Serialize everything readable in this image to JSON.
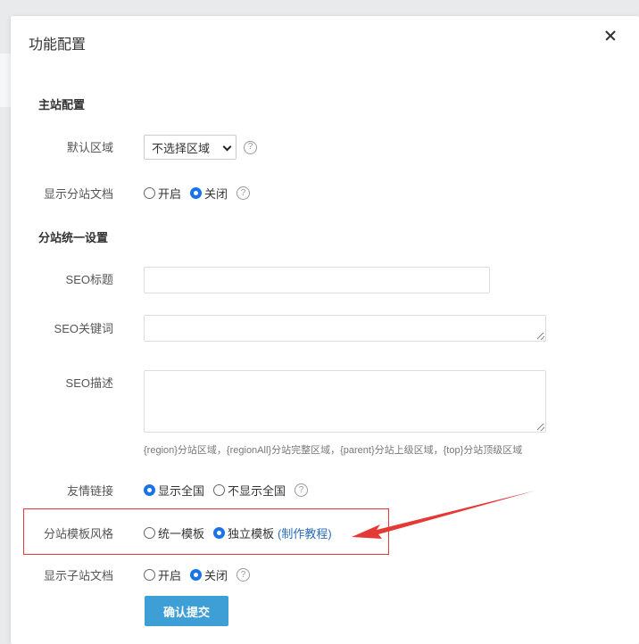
{
  "dialog": {
    "title": "功能配置"
  },
  "main_config": {
    "section_title": "主站配置",
    "default_region": {
      "label": "默认区域",
      "selected": "不选择区域",
      "help": "?"
    },
    "show_sub_docs": {
      "label": "显示分站文档",
      "options": [
        "开启",
        "关闭"
      ],
      "selected": "关闭",
      "help": "?"
    }
  },
  "sub_config": {
    "section_title": "分站统一设置",
    "seo_title": {
      "label": "SEO标题",
      "value": ""
    },
    "seo_keywords": {
      "label": "SEO关键词",
      "value": ""
    },
    "seo_description": {
      "label": "SEO描述",
      "value": ""
    },
    "variables_hint": "{region}分站区域，{regionAll}分站完整区域，{parent}分站上级区域，{top}分站顶级区域",
    "friend_links": {
      "label": "友情链接",
      "options": [
        "显示全国",
        "不显示全国"
      ],
      "selected": "显示全国",
      "help": "?"
    },
    "template_style": {
      "label": "分站模板风格",
      "options": [
        "统一模板",
        "独立模板"
      ],
      "selected": "独立模板",
      "tutorial_link": "(制作教程)"
    },
    "show_child_docs": {
      "label": "显示子站文档",
      "options": [
        "开启",
        "关闭"
      ],
      "selected": "关闭",
      "help": "?"
    }
  },
  "submit_label": "确认提交",
  "colors": {
    "primary": "#3d9fd6",
    "radio_checked": "#1a73e8",
    "annotation": "#e53935",
    "link": "#2a6db5"
  }
}
